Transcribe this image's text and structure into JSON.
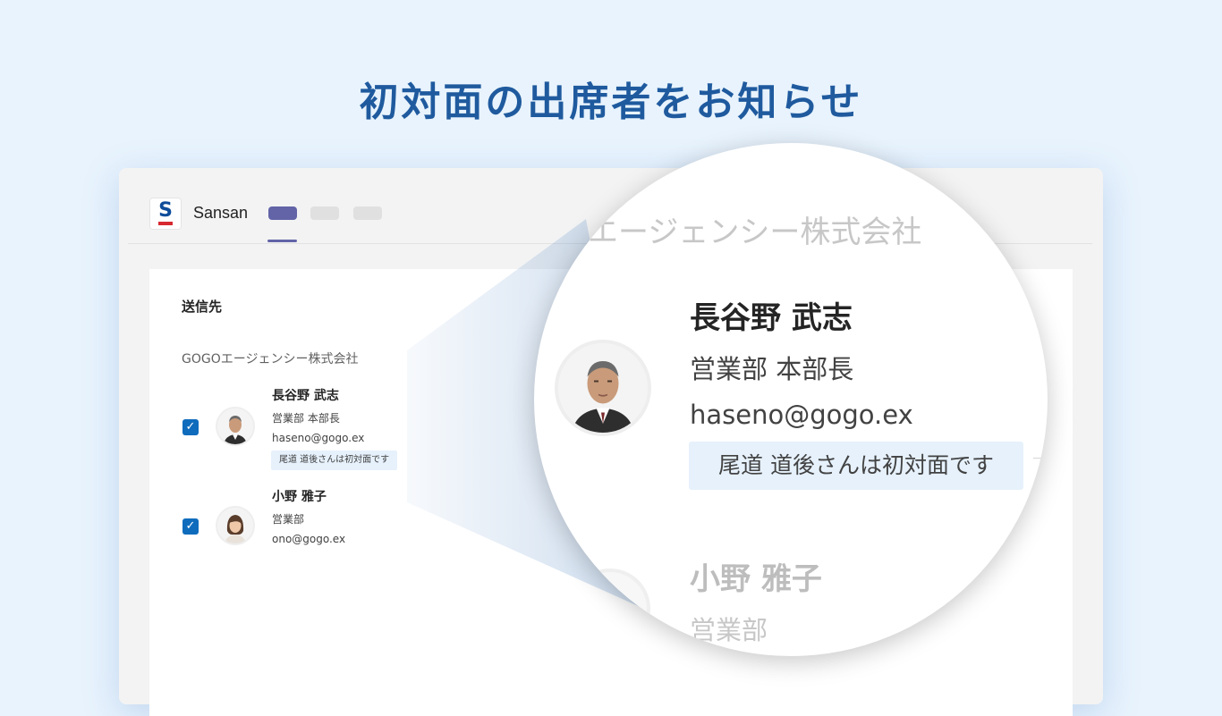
{
  "headline": "初対面の出席者をお知らせ",
  "app": {
    "logo_letter": "S",
    "name": "Sansan",
    "brand_colors": {
      "blue": "#0e4c9a",
      "red": "#d7282f",
      "accent": "#6264a7"
    }
  },
  "panel": {
    "section_title": "送信先",
    "company": "GOGOエージェンシー株式会社",
    "contacts": [
      {
        "checked": true,
        "name": "長谷野 武志",
        "department": "営業部 本部長",
        "email": "haseno@gogo.ex",
        "note": "尾道 道後さんは初対面です"
      },
      {
        "checked": true,
        "name": "小野 雅子",
        "department": "営業部",
        "email": "ono@gogo.ex"
      }
    ]
  },
  "magnifier": {
    "company_fragment": "エージェンシー株式会社",
    "name": "長谷野 武志",
    "department": "営業部 本部長",
    "email": "haseno@gogo.ex",
    "note": "尾道 道後さんは初対面です",
    "next_name": "小野 雅子",
    "next_department": "営業部"
  }
}
